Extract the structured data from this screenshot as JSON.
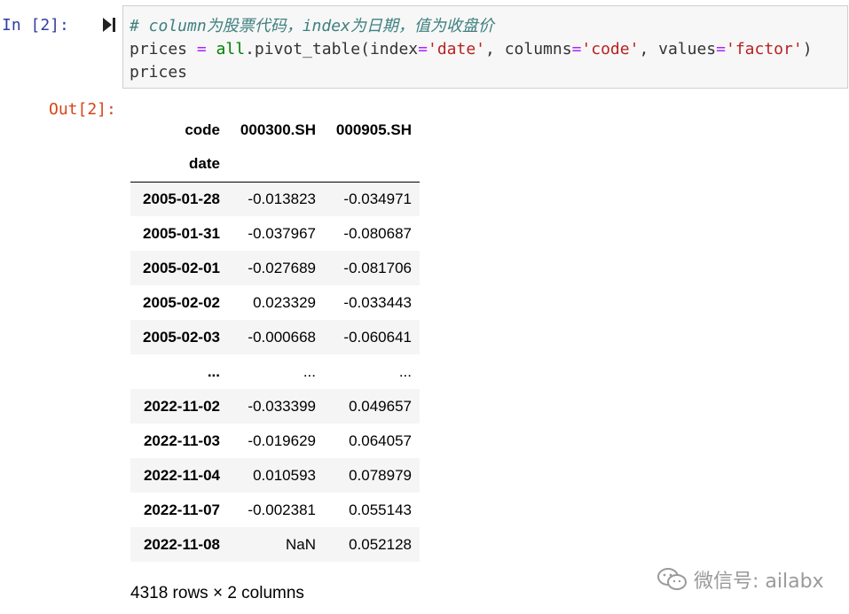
{
  "input_cell": {
    "prompt": "In  [2]:",
    "code_lines": [
      [
        {
          "t": "# column为股票代码，index为日期，值为收盘价",
          "c": "c-comment"
        }
      ],
      [
        {
          "t": "prices ",
          "c": ""
        },
        {
          "t": "=",
          "c": "c-op"
        },
        {
          "t": " ",
          "c": ""
        },
        {
          "t": "all",
          "c": "c-builtin"
        },
        {
          "t": ".pivot_table(index",
          "c": ""
        },
        {
          "t": "=",
          "c": "c-op"
        },
        {
          "t": "'date'",
          "c": "c-str"
        },
        {
          "t": ", columns",
          "c": ""
        },
        {
          "t": "=",
          "c": "c-op"
        },
        {
          "t": "'code'",
          "c": "c-str"
        },
        {
          "t": ", values",
          "c": ""
        },
        {
          "t": "=",
          "c": "c-op"
        },
        {
          "t": "'factor'",
          "c": "c-str"
        },
        {
          "t": ")",
          "c": ""
        }
      ],
      [
        {
          "t": "prices",
          "c": ""
        }
      ]
    ]
  },
  "output_cell": {
    "prompt": "Out[2]:",
    "table": {
      "columns_name": "code",
      "index_name": "date",
      "columns": [
        "000300.SH",
        "000905.SH"
      ],
      "rows": [
        [
          "2005-01-28",
          "-0.013823",
          "-0.034971"
        ],
        [
          "2005-01-31",
          "-0.037967",
          "-0.080687"
        ],
        [
          "2005-02-01",
          "-0.027689",
          "-0.081706"
        ],
        [
          "2005-02-02",
          "0.023329",
          "-0.033443"
        ],
        [
          "2005-02-03",
          "-0.000668",
          "-0.060641"
        ],
        [
          "...",
          "...",
          "..."
        ],
        [
          "2022-11-02",
          "-0.033399",
          "0.049657"
        ],
        [
          "2022-11-03",
          "-0.019629",
          "0.064057"
        ],
        [
          "2022-11-04",
          "0.010593",
          "0.078979"
        ],
        [
          "2022-11-07",
          "-0.002381",
          "0.055143"
        ],
        [
          "2022-11-08",
          "NaN",
          "0.052128"
        ]
      ]
    },
    "shape_text": "4318 rows × 2 columns"
  },
  "watermark": {
    "icon": "wechat-icon",
    "text": "微信号: ailabx"
  }
}
